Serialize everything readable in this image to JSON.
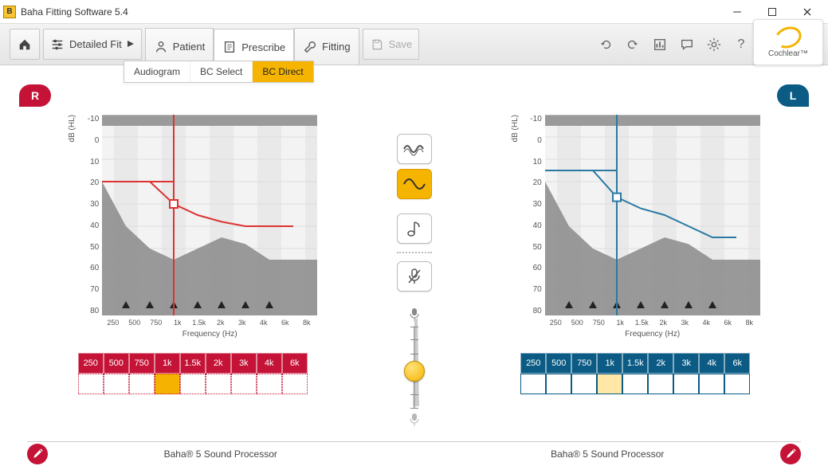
{
  "window": {
    "title": "Baha Fitting Software 5.4",
    "icon_letter": "B"
  },
  "toolbar": {
    "home_label": "",
    "detailed_fit": "Detailed Fit",
    "patient": "Patient",
    "prescribe": "Prescribe",
    "fitting": "Fitting",
    "save": "Save"
  },
  "subribbon": {
    "audiogram": "Audiogram",
    "bc_select": "BC Select",
    "bc_direct": "BC Direct"
  },
  "brand": "Cochlear™",
  "ears": {
    "right": "R",
    "left": "L"
  },
  "axes": {
    "y_label": "dB (HL)",
    "x_label": "Frequency (Hz)",
    "y_ticks": [
      "-10",
      "0",
      "10",
      "20",
      "30",
      "40",
      "50",
      "60",
      "70",
      "80"
    ],
    "x_ticks": [
      "250",
      "500",
      "750",
      "1k",
      "1.5k",
      "2k",
      "3k",
      "4k",
      "6k",
      "8k"
    ]
  },
  "freq_headers": [
    "250",
    "500",
    "750",
    "1k",
    "1.5k",
    "2k",
    "3k",
    "4k",
    "6k"
  ],
  "selected_freq_index": {
    "right": 3,
    "left": 3
  },
  "cursor_freq": "1k",
  "chart_data": [
    {
      "side": "right",
      "type": "line",
      "xlabel": "Frequency (Hz)",
      "ylabel": "dB (HL)",
      "ylim": [
        -10,
        80
      ],
      "x": [
        "250",
        "500",
        "750",
        "1k",
        "1.5k",
        "2k",
        "3k",
        "4k",
        "6k",
        "8k"
      ],
      "series": [
        {
          "name": "threshold",
          "values": [
            20,
            20,
            20,
            30,
            35,
            38,
            40,
            40,
            40,
            null
          ],
          "color": "#d33"
        },
        {
          "name": "speech_banana_upper",
          "values": [
            20,
            40,
            50,
            55,
            50,
            45,
            48,
            55,
            55,
            55
          ],
          "color": "#888",
          "fill_to": 80
        }
      ],
      "cursor_freq": "1k",
      "cursor_value": 30,
      "markers_at_x": [
        "500",
        "750",
        "1k",
        "1.5k",
        "2k",
        "3k",
        "4k"
      ]
    },
    {
      "side": "left",
      "type": "line",
      "xlabel": "Frequency (Hz)",
      "ylabel": "dB (HL)",
      "ylim": [
        -10,
        80
      ],
      "x": [
        "250",
        "500",
        "750",
        "1k",
        "1.5k",
        "2k",
        "3k",
        "4k",
        "6k",
        "8k"
      ],
      "series": [
        {
          "name": "threshold",
          "values": [
            15,
            15,
            15,
            27,
            32,
            35,
            40,
            45,
            45,
            null
          ],
          "color": "#2a7aa3"
        },
        {
          "name": "speech_banana_upper",
          "values": [
            20,
            40,
            50,
            55,
            50,
            45,
            48,
            55,
            55,
            55
          ],
          "color": "#888",
          "fill_to": 80
        }
      ],
      "cursor_freq": "1k",
      "cursor_value": 27,
      "markers_at_x": [
        "500",
        "750",
        "1k",
        "1.5k",
        "2k",
        "3k",
        "4k"
      ]
    }
  ],
  "mid": {
    "signal1": "warble",
    "signal2": "pure-tone",
    "signal3": "narrowband",
    "mute": "mute",
    "slider_position": 0.55
  },
  "footer": {
    "device_right": "Baha® 5 Sound Processor",
    "device_left": "Baha® 5 Sound Processor"
  }
}
